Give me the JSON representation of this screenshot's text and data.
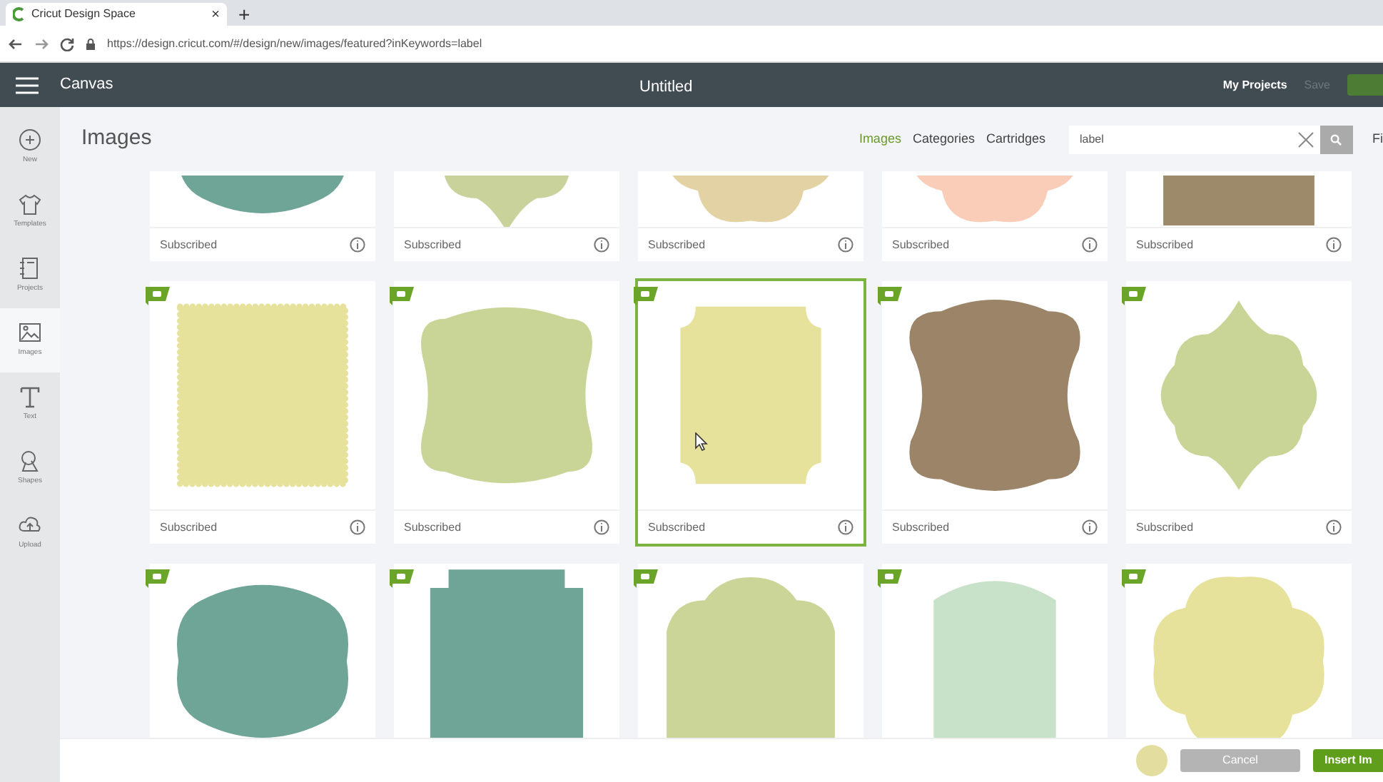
{
  "browser": {
    "tab_title": "Cricut Design Space",
    "tab_close": "×",
    "new_tab": "+",
    "url": "https://design.cricut.com/#/design/new/images/featured?inKeywords=label"
  },
  "header": {
    "menu_label": "Canvas",
    "title": "Untitled",
    "my_projects": "My Projects",
    "save": {
      "label": "Save",
      "disabled": true
    }
  },
  "sidebar": {
    "items": [
      {
        "label": "New",
        "selected": false
      },
      {
        "label": "Templates",
        "selected": false
      },
      {
        "label": "Projects",
        "selected": false
      },
      {
        "label": "Images",
        "selected": true
      },
      {
        "label": "Text",
        "selected": false
      },
      {
        "label": "Shapes",
        "selected": false
      },
      {
        "label": "Upload",
        "selected": false
      }
    ]
  },
  "panel": {
    "title": "Images",
    "tabs": [
      {
        "label": "Images",
        "selected": true
      },
      {
        "label": "Categories",
        "selected": false
      },
      {
        "label": "Cartridges",
        "selected": false
      }
    ],
    "search": {
      "value": "label"
    },
    "filter_label": "Fi"
  },
  "image_rows": [
    {
      "cards": [
        {
          "kind": "picture",
          "label": "Subscribed",
          "selected": false
        },
        {
          "kind": "picture",
          "label": "Subscribed",
          "selected": false
        },
        {
          "kind": "picture",
          "label": "Subscribed",
          "selected": false
        },
        {
          "kind": "picture",
          "label": "Subscribed",
          "selected": false
        },
        {
          "kind": "picture",
          "label": "Subscribed",
          "selected": false
        }
      ]
    },
    {
      "cards": [
        {
          "kind": "picture",
          "label": "Subscribed",
          "selected": false,
          "flag": true
        },
        {
          "kind": "picture",
          "label": "Subscribed",
          "selected": false,
          "flag": true
        },
        {
          "kind": "picture",
          "label": "Subscribed",
          "selected": true,
          "flag": true
        },
        {
          "kind": "picture",
          "label": "Subscribed",
          "selected": false,
          "flag": true
        },
        {
          "kind": "picture",
          "label": "Subscribed",
          "selected": false,
          "flag": true
        }
      ]
    },
    {
      "cards": [
        {
          "kind": "picture",
          "selected": false,
          "flag": true
        },
        {
          "kind": "picture",
          "selected": false,
          "flag": true
        },
        {
          "kind": "picture",
          "selected": false,
          "flag": true
        },
        {
          "kind": "picture",
          "selected": false,
          "flag": true
        },
        {
          "kind": "picture",
          "selected": false,
          "flag": true
        }
      ]
    }
  ],
  "footer": {
    "cancel": "Cancel",
    "insert": "Insert Im"
  }
}
